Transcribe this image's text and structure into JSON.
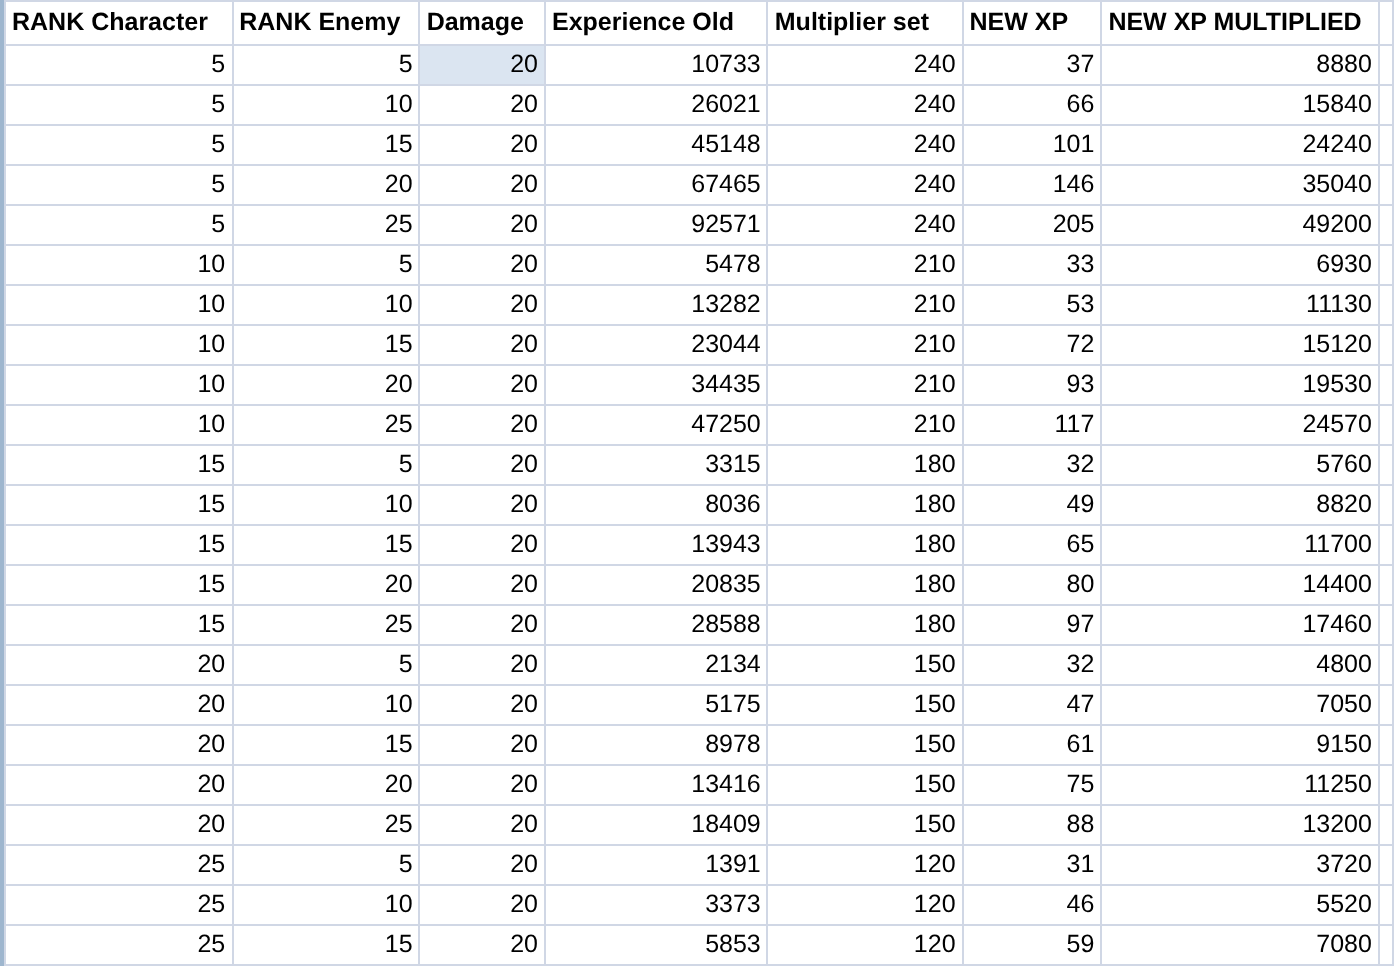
{
  "table": {
    "columns": [
      "RANK Character",
      "RANK Enemy",
      "Damage",
      "Experience Old",
      "Multiplier set",
      "NEW XP",
      "NEW XP MULTIPLIED"
    ],
    "rows": [
      {
        "cells": [
          "5",
          "5",
          "20",
          "10733",
          "240",
          "37",
          "8880"
        ],
        "selected_cells": [
          false,
          false,
          true,
          false,
          false,
          false,
          false
        ]
      },
      {
        "cells": [
          "5",
          "10",
          "20",
          "26021",
          "240",
          "66",
          "15840"
        ],
        "selected_cells": [
          false,
          false,
          false,
          false,
          false,
          false,
          false
        ]
      },
      {
        "cells": [
          "5",
          "15",
          "20",
          "45148",
          "240",
          "101",
          "24240"
        ],
        "selected_cells": [
          false,
          false,
          false,
          false,
          false,
          false,
          false
        ]
      },
      {
        "cells": [
          "5",
          "20",
          "20",
          "67465",
          "240",
          "146",
          "35040"
        ],
        "selected_cells": [
          false,
          false,
          false,
          false,
          false,
          false,
          false
        ]
      },
      {
        "cells": [
          "5",
          "25",
          "20",
          "92571",
          "240",
          "205",
          "49200"
        ],
        "selected_cells": [
          false,
          false,
          false,
          false,
          false,
          false,
          false
        ]
      },
      {
        "cells": [
          "10",
          "5",
          "20",
          "5478",
          "210",
          "33",
          "6930"
        ],
        "selected_cells": [
          false,
          false,
          false,
          false,
          false,
          false,
          false
        ]
      },
      {
        "cells": [
          "10",
          "10",
          "20",
          "13282",
          "210",
          "53",
          "11130"
        ],
        "selected_cells": [
          false,
          false,
          false,
          false,
          false,
          false,
          false
        ]
      },
      {
        "cells": [
          "10",
          "15",
          "20",
          "23044",
          "210",
          "72",
          "15120"
        ],
        "selected_cells": [
          false,
          false,
          false,
          false,
          false,
          false,
          false
        ]
      },
      {
        "cells": [
          "10",
          "20",
          "20",
          "34435",
          "210",
          "93",
          "19530"
        ],
        "selected_cells": [
          false,
          false,
          false,
          false,
          false,
          false,
          false
        ]
      },
      {
        "cells": [
          "10",
          "25",
          "20",
          "47250",
          "210",
          "117",
          "24570"
        ],
        "selected_cells": [
          false,
          false,
          false,
          false,
          false,
          false,
          false
        ]
      },
      {
        "cells": [
          "15",
          "5",
          "20",
          "3315",
          "180",
          "32",
          "5760"
        ],
        "selected_cells": [
          false,
          false,
          false,
          false,
          false,
          false,
          false
        ]
      },
      {
        "cells": [
          "15",
          "10",
          "20",
          "8036",
          "180",
          "49",
          "8820"
        ],
        "selected_cells": [
          false,
          false,
          false,
          false,
          false,
          false,
          false
        ]
      },
      {
        "cells": [
          "15",
          "15",
          "20",
          "13943",
          "180",
          "65",
          "11700"
        ],
        "selected_cells": [
          false,
          false,
          false,
          false,
          false,
          false,
          false
        ]
      },
      {
        "cells": [
          "15",
          "20",
          "20",
          "20835",
          "180",
          "80",
          "14400"
        ],
        "selected_cells": [
          false,
          false,
          false,
          false,
          false,
          false,
          false
        ]
      },
      {
        "cells": [
          "15",
          "25",
          "20",
          "28588",
          "180",
          "97",
          "17460"
        ],
        "selected_cells": [
          false,
          false,
          false,
          false,
          false,
          false,
          false
        ]
      },
      {
        "cells": [
          "20",
          "5",
          "20",
          "2134",
          "150",
          "32",
          "4800"
        ],
        "selected_cells": [
          false,
          false,
          false,
          false,
          false,
          false,
          false
        ]
      },
      {
        "cells": [
          "20",
          "10",
          "20",
          "5175",
          "150",
          "47",
          "7050"
        ],
        "selected_cells": [
          false,
          false,
          false,
          false,
          false,
          false,
          false
        ]
      },
      {
        "cells": [
          "20",
          "15",
          "20",
          "8978",
          "150",
          "61",
          "9150"
        ],
        "selected_cells": [
          false,
          false,
          false,
          false,
          false,
          false,
          false
        ]
      },
      {
        "cells": [
          "20",
          "20",
          "20",
          "13416",
          "150",
          "75",
          "11250"
        ],
        "selected_cells": [
          false,
          false,
          false,
          false,
          false,
          false,
          false
        ]
      },
      {
        "cells": [
          "20",
          "25",
          "20",
          "18409",
          "150",
          "88",
          "13200"
        ],
        "selected_cells": [
          false,
          false,
          false,
          false,
          false,
          false,
          false
        ]
      },
      {
        "cells": [
          "25",
          "5",
          "20",
          "1391",
          "120",
          "31",
          "3720"
        ],
        "selected_cells": [
          false,
          false,
          false,
          false,
          false,
          false,
          false
        ]
      },
      {
        "cells": [
          "25",
          "10",
          "20",
          "3373",
          "120",
          "46",
          "5520"
        ],
        "selected_cells": [
          false,
          false,
          false,
          false,
          false,
          false,
          false
        ]
      },
      {
        "cells": [
          "25",
          "15",
          "20",
          "5853",
          "120",
          "59",
          "7080"
        ],
        "selected_cells": [
          false,
          false,
          false,
          false,
          false,
          false,
          false
        ]
      }
    ]
  }
}
